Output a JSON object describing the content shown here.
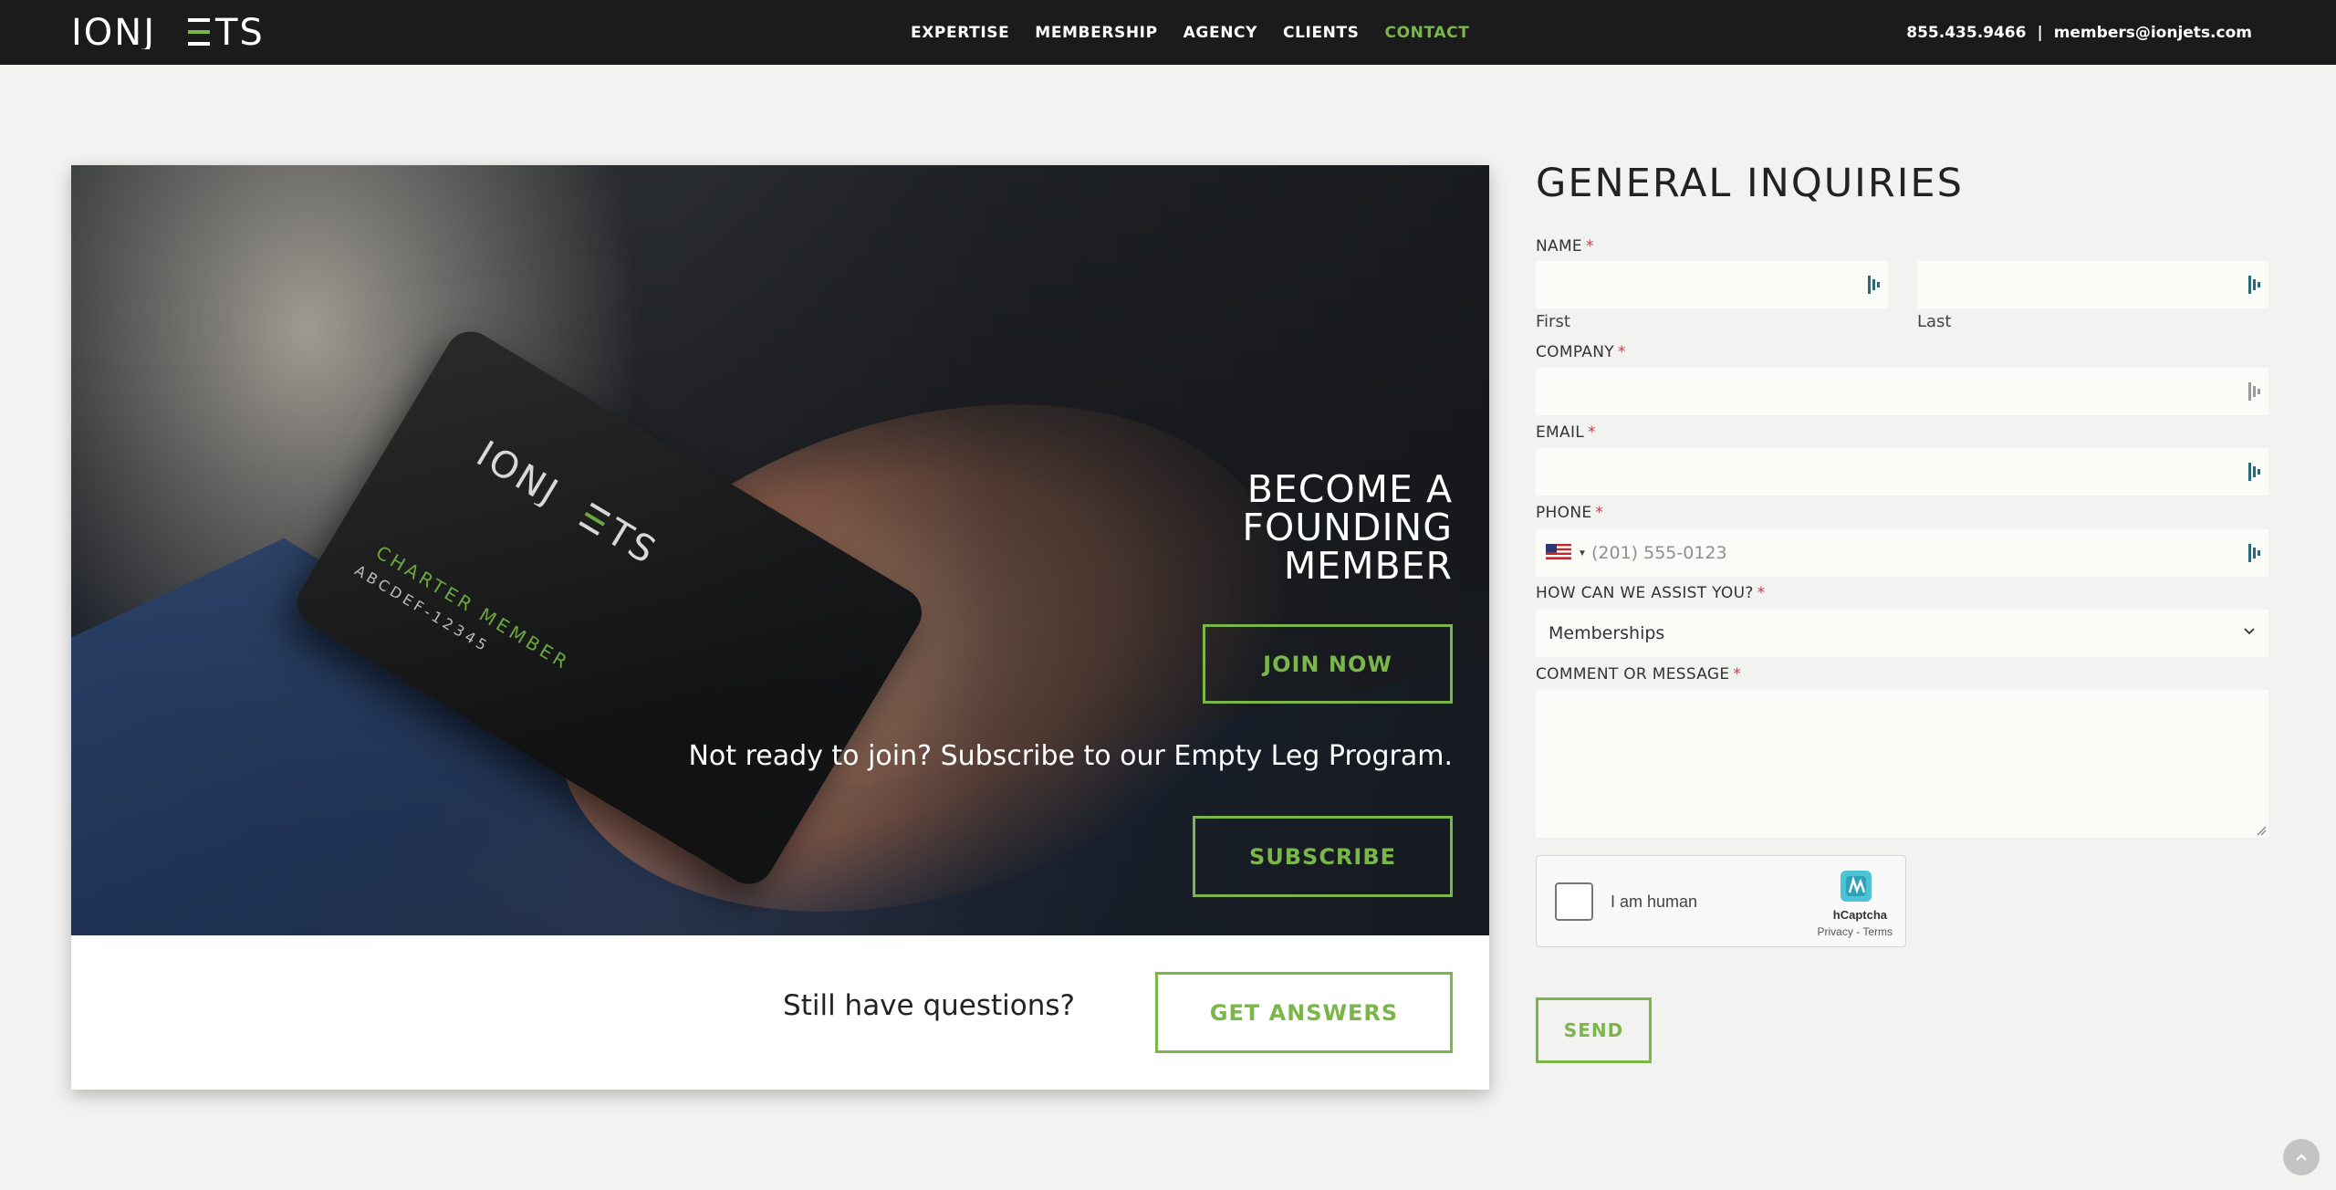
{
  "header": {
    "logo_text": "IONJETS",
    "nav": [
      {
        "label": "EXPERTISE",
        "active": false
      },
      {
        "label": "MEMBERSHIP",
        "active": false
      },
      {
        "label": "AGENCY",
        "active": false
      },
      {
        "label": "CLIENTS",
        "active": false
      },
      {
        "label": "CONTACT",
        "active": true
      }
    ],
    "phone": "855.435.9466",
    "separator": "|",
    "email": "members@ionjets.com"
  },
  "hero": {
    "card_logo": "IONJETS",
    "card_tier": "CHARTER MEMBER",
    "card_id": "ABCDEF-12345",
    "title_line1": "BECOME A",
    "title_line2": "FOUNDING",
    "title_line3": "MEMBER",
    "join_label": "JOIN NOW",
    "subscribe_text": "Not ready to join? Subscribe to our Empty Leg Program.",
    "subscribe_label": "SUBSCRIBE"
  },
  "questions": {
    "text": "Still have questions?",
    "button_label": "GET ANSWERS"
  },
  "form": {
    "title": "GENERAL INQUIRIES",
    "name_label": "NAME",
    "required_mark": "*",
    "first_label": "First",
    "last_label": "Last",
    "first_value": "",
    "last_value": "",
    "company_label": "COMPANY",
    "company_value": "",
    "email_label": "EMAIL",
    "email_value": "",
    "phone_label": "PHONE",
    "phone_placeholder": "(201) 555-0123",
    "phone_country": "US",
    "assist_label": "HOW CAN WE ASSIST YOU?",
    "assist_selected": "Memberships",
    "message_label": "COMMENT OR MESSAGE",
    "captcha_text": "I am human",
    "captcha_brand": "hCaptcha",
    "captcha_privacy": "Privacy",
    "captcha_sep": "-",
    "captcha_terms": "Terms",
    "send_label": "SEND"
  },
  "colors": {
    "accent": "#7ab648",
    "header_bg": "#1b1b1b",
    "page_bg": "#f2f2f0",
    "required": "#d9363e"
  },
  "icons": {
    "field_autofill": "password-manager-icon",
    "scroll_top": "chevron-up-icon",
    "select_caret": "chevron-down-icon",
    "captcha": "hcaptcha-logo-icon",
    "flag": "us-flag-icon"
  }
}
